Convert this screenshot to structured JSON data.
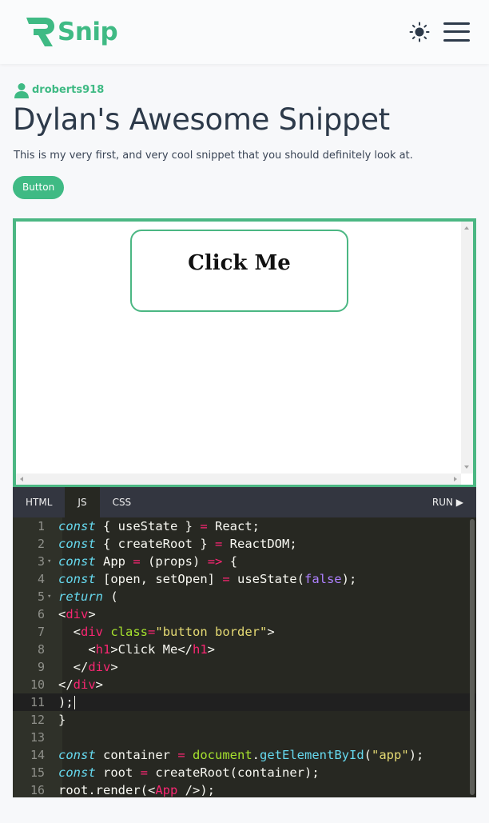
{
  "header": {
    "brand": "Snip",
    "icons": {
      "logo": "logo-mark",
      "theme": "sun-icon",
      "menu": "hamburger-menu-icon"
    }
  },
  "snippet": {
    "author": "droberts918",
    "title": "Dylan's Awesome Snippet",
    "description": "This is my very first, and very cool snippet that you should definitely look at.",
    "tag_label": "Button"
  },
  "preview": {
    "demo_text": "Click Me"
  },
  "editor": {
    "tabs": [
      "HTML",
      "JS",
      "CSS"
    ],
    "active_tab": "JS",
    "run_label": "RUN ▶",
    "active_line": 11,
    "lines": [
      "const { useState } = React;",
      "const { createRoot } = ReactDOM;",
      "const App = (props) => {",
      "const [open, setOpen] = useState(false);",
      "return (",
      "<div>",
      "  <div class=\"button border\">",
      "    <h1>Click Me</h1>",
      "  </div>",
      "</div>",
      ");",
      "}",
      "",
      "const container = document.getElementById(\"app\");",
      "const root = createRoot(container);",
      "root.render(<App />);"
    ]
  },
  "colors": {
    "brand": "#3fba84",
    "text": "#2d3a4a",
    "editor_bg": "#272822",
    "tab_bar": "#333640"
  }
}
